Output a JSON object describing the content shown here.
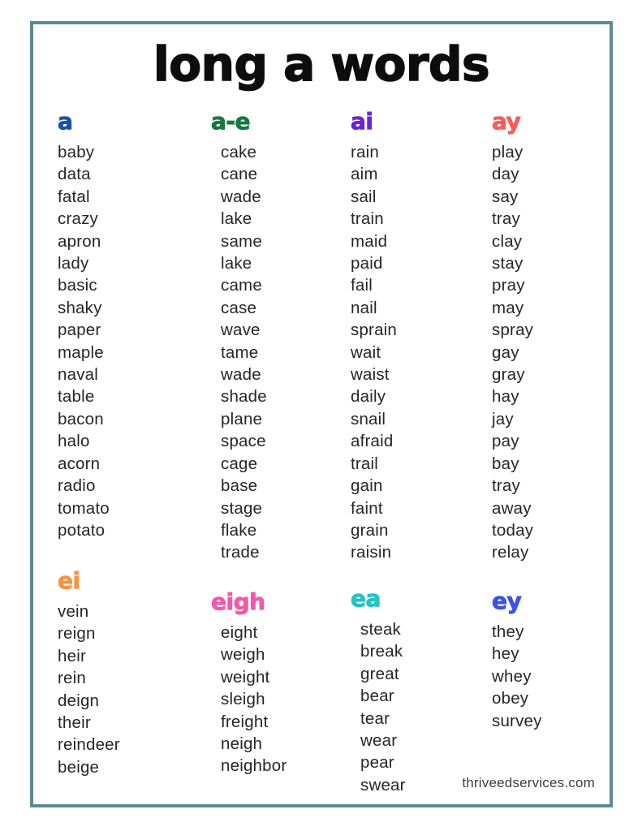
{
  "page": {
    "title": "long a words",
    "footer": "thriveedservices.com",
    "border_color": "#5d8a95",
    "background_color": "#ffffff",
    "text_color": "#262626"
  },
  "sections": [
    {
      "header": "a",
      "color": "#1a52a8",
      "words": [
        "baby",
        "data",
        "fatal",
        "crazy",
        "apron",
        "lady",
        "basic",
        "shaky",
        "paper",
        "maple",
        "naval",
        "table",
        "bacon",
        "halo",
        "acorn",
        "radio",
        "tomato",
        "potato"
      ]
    },
    {
      "header": "a-e",
      "color": "#16793f",
      "words": [
        "cake",
        "cane",
        "wade",
        "lake",
        "same",
        "lake",
        "came",
        "case",
        "wave",
        "tame",
        "wade",
        "shade",
        "plane",
        "space",
        "cage",
        "base",
        "stage",
        "flake",
        "trade"
      ]
    },
    {
      "header": "ai",
      "color": "#6b24d6",
      "words": [
        "rain",
        "aim",
        "sail",
        "train",
        "maid",
        "paid",
        "fail",
        "nail",
        "sprain",
        "wait",
        "waist",
        "daily",
        "snail",
        "afraid",
        "trail",
        "gain",
        "faint",
        "grain",
        "raisin"
      ]
    },
    {
      "header": "ay",
      "color": "#fb5b5b",
      "words": [
        "play",
        "day",
        "say",
        "tray",
        "clay",
        "stay",
        "pray",
        "may",
        "spray",
        "gay",
        "gray",
        "hay",
        "jay",
        "pay",
        "bay",
        "tray",
        "away",
        "today",
        "relay"
      ]
    },
    {
      "header": "ei",
      "color": "#f79342",
      "words": [
        "vein",
        "reign",
        "heir",
        "rein",
        "deign",
        "their",
        "reindeer",
        "beige"
      ]
    },
    {
      "header": "eigh",
      "color": "#f457ab",
      "words": [
        "eight",
        "weigh",
        "weight",
        "sleigh",
        "freight",
        "neigh",
        "neighbor"
      ]
    },
    {
      "header": "ea",
      "color": "#21c4c4",
      "words": [
        "steak",
        "break",
        "great",
        "bear",
        "tear",
        "wear",
        "pear",
        "swear"
      ]
    },
    {
      "header": "ey",
      "color": "#3b52e8",
      "words": [
        "they",
        "hey",
        "whey",
        "obey",
        "survey"
      ]
    }
  ]
}
